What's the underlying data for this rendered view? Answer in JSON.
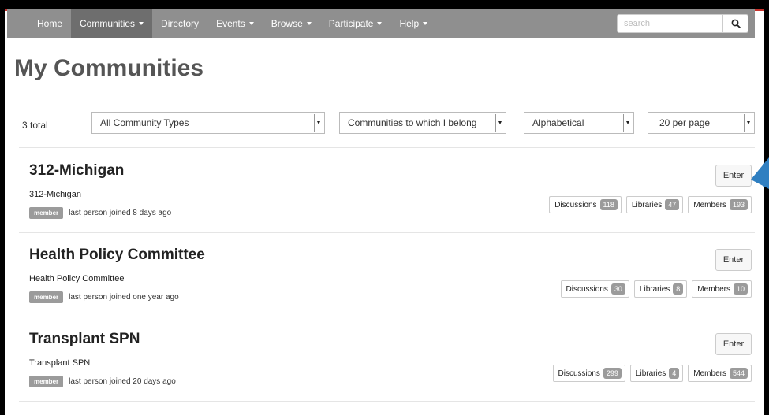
{
  "nav": {
    "items": [
      {
        "label": "Home",
        "dropdown": false,
        "active": false
      },
      {
        "label": "Communities",
        "dropdown": true,
        "active": true
      },
      {
        "label": "Directory",
        "dropdown": false,
        "active": false
      },
      {
        "label": "Events",
        "dropdown": true,
        "active": false
      },
      {
        "label": "Browse",
        "dropdown": true,
        "active": false
      },
      {
        "label": "Participate",
        "dropdown": true,
        "active": false
      },
      {
        "label": "Help",
        "dropdown": true,
        "active": false
      }
    ],
    "search_placeholder": "search",
    "search_icon": "magnifier-icon"
  },
  "page": {
    "title": "My Communities"
  },
  "filters": {
    "total": "3 total",
    "community_type": "All Community Types",
    "membership": "Communities to which I belong",
    "sort": "Alphabetical",
    "per_page": "20 per page"
  },
  "communities": [
    {
      "title": "312-Michigan",
      "subtitle": "312-Michigan",
      "badge": "member",
      "joined": "last person joined 8 days ago",
      "enter_label": "Enter",
      "stats": [
        {
          "label": "Discussions",
          "count": "118"
        },
        {
          "label": "Libraries",
          "count": "47"
        },
        {
          "label": "Members",
          "count": "193"
        }
      ]
    },
    {
      "title": "Health Policy Committee",
      "subtitle": "Health Policy Committee",
      "badge": "member",
      "joined": "last person joined one year ago",
      "enter_label": "Enter",
      "stats": [
        {
          "label": "Discussions",
          "count": "30"
        },
        {
          "label": "Libraries",
          "count": "8"
        },
        {
          "label": "Members",
          "count": "10"
        }
      ]
    },
    {
      "title": "Transplant SPN",
      "subtitle": "Transplant SPN",
      "badge": "member",
      "joined": "last person joined 20 days ago",
      "enter_label": "Enter",
      "stats": [
        {
          "label": "Discussions",
          "count": "299"
        },
        {
          "label": "Libraries",
          "count": "4"
        },
        {
          "label": "Members",
          "count": "544"
        }
      ]
    }
  ],
  "colors": {
    "nav_bg": "#8f8f8f",
    "nav_active": "#6e6e6e",
    "badge": "#9b9b9b",
    "accent_arrow": "#2f7fc1",
    "top_border": "#c8302a"
  }
}
